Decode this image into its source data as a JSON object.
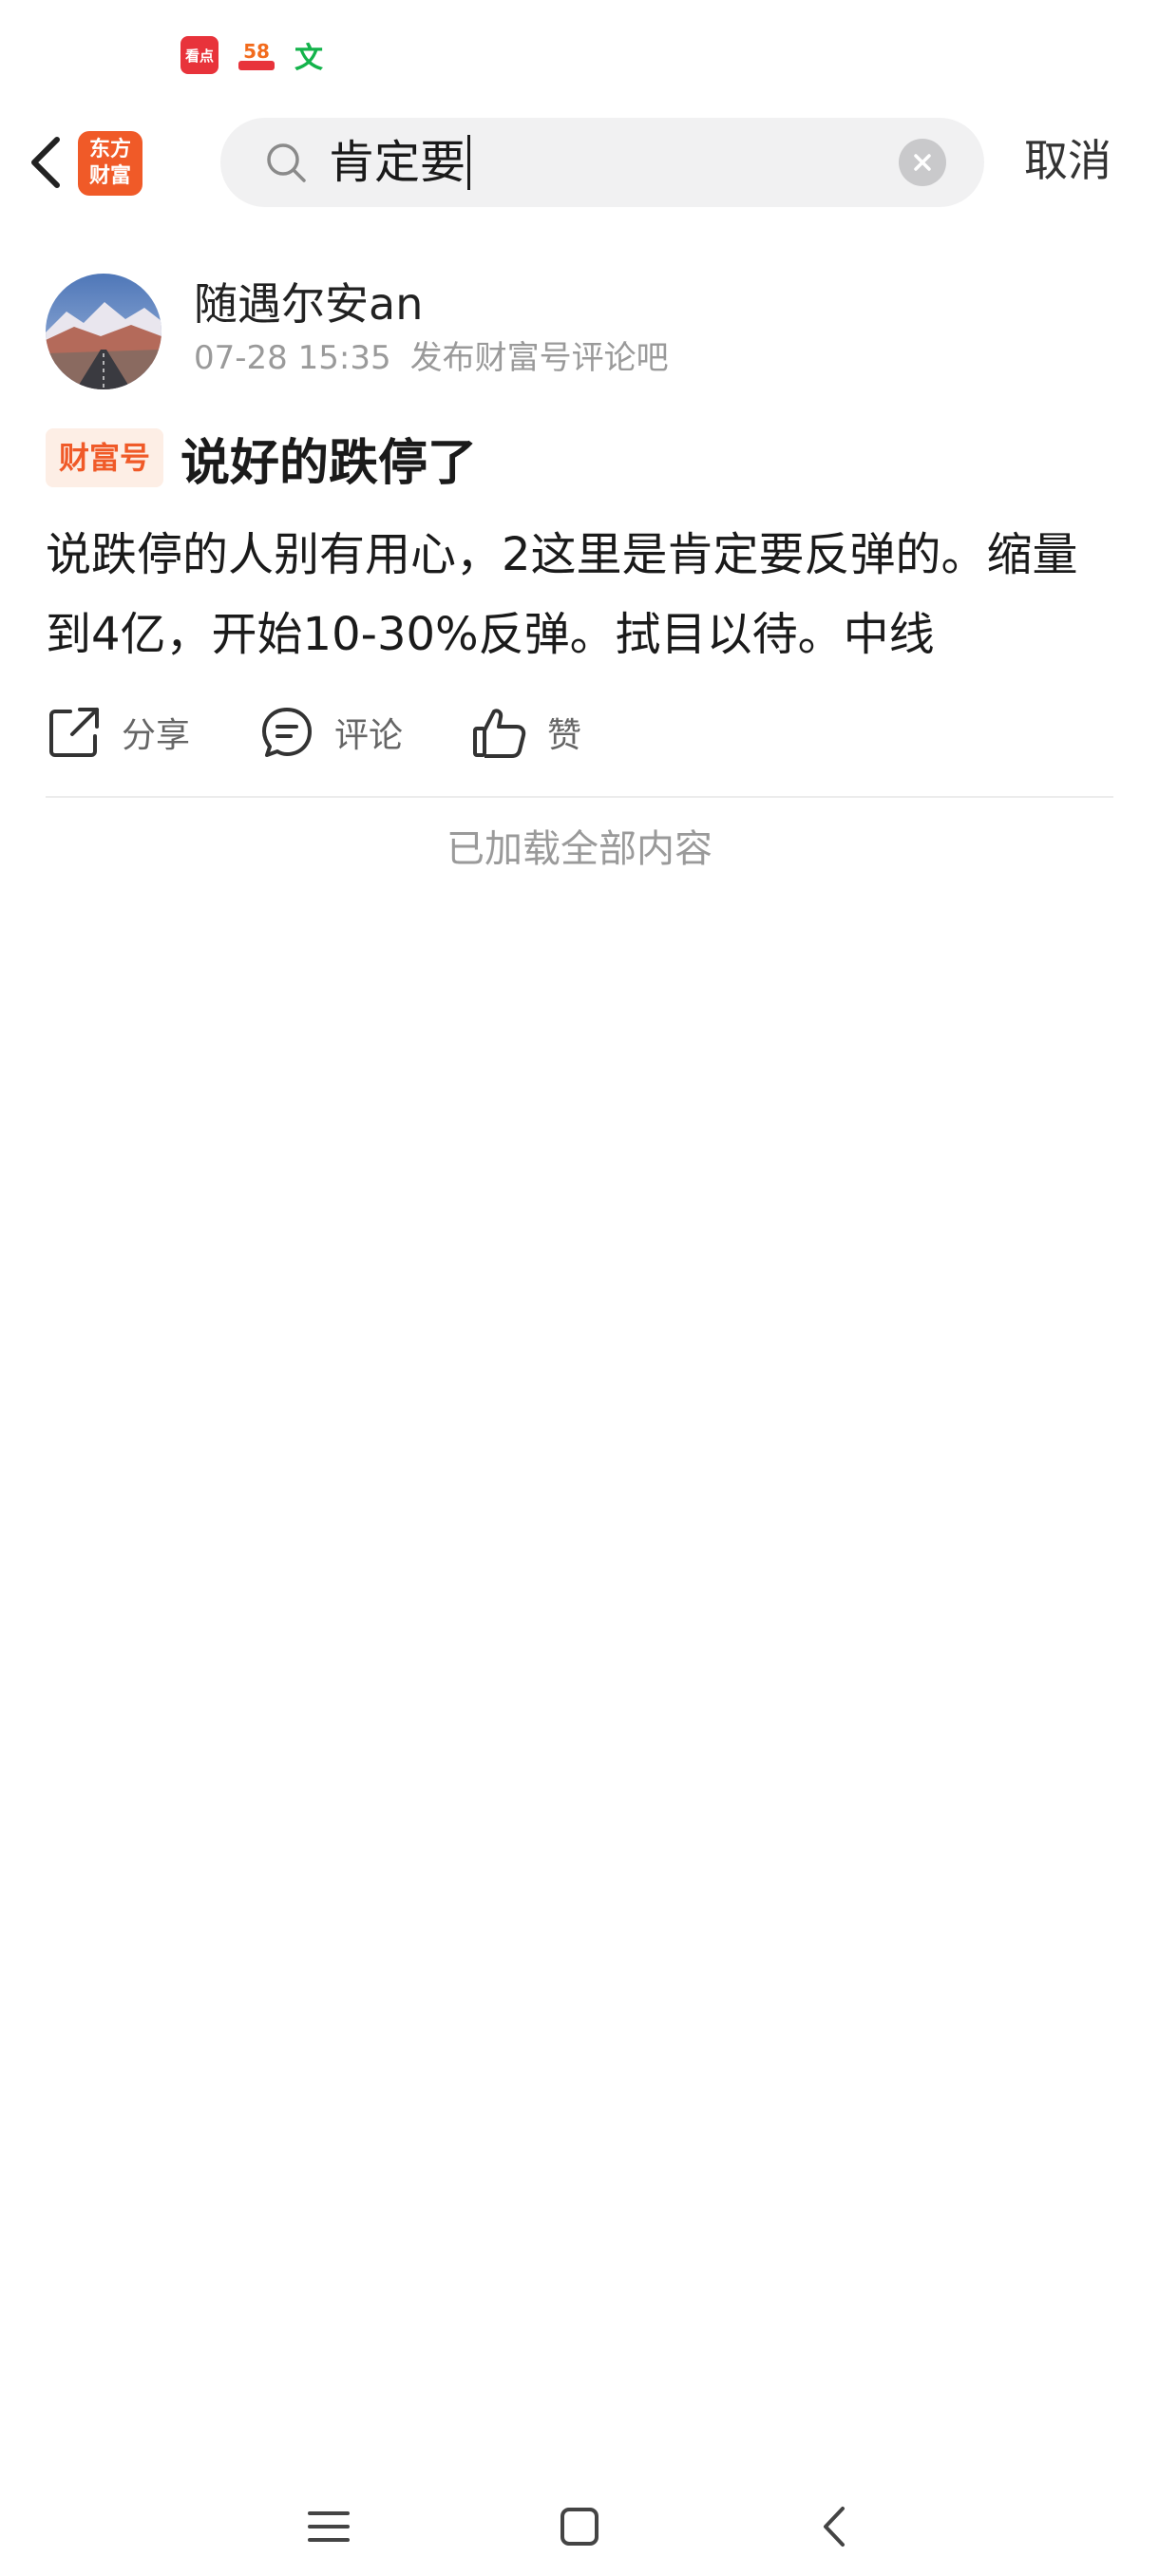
{
  "status_bar": {
    "icons": [
      "kandian-app-icon",
      "58-app-icon",
      "wen-app-icon"
    ],
    "kandian_label": "看点",
    "app58_label": "58",
    "wen_label": "文"
  },
  "header": {
    "back_icon": "chevron-left-icon",
    "logo_line1": "东方",
    "logo_line2": "财富",
    "search_value": "肯定要",
    "cancel_label": "取消"
  },
  "post": {
    "author": "随遇尔安an",
    "time": "07-28 15:35",
    "source": "发布财富号评论吧",
    "badge": "财富号",
    "title": "说好的跌停了",
    "body": "说跌停的人别有用心，2这里是肯定要反弹的。缩量到4亿，开始10-30%反弹。拭目以待。中线",
    "actions": {
      "share": "分享",
      "comment": "评论",
      "like": "赞"
    }
  },
  "footer": {
    "all_loaded": "已加载全部内容"
  },
  "colors": {
    "brand": "#f05a28",
    "badge_bg": "#fdeee5",
    "muted": "#9a9a9a",
    "search_bg": "#f1f1f2"
  }
}
